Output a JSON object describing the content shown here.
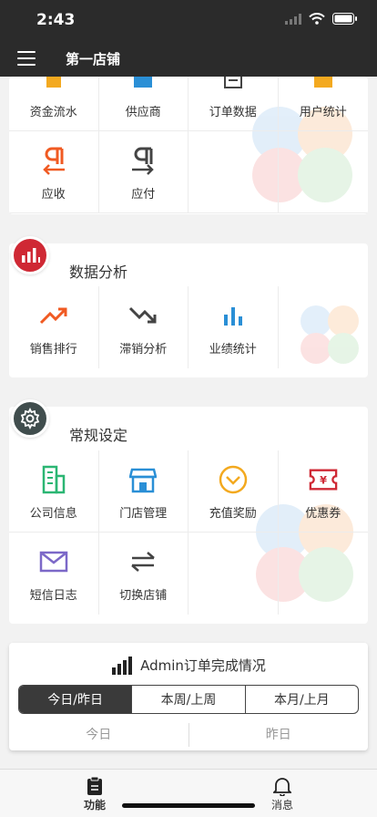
{
  "status_bar": {
    "time": "2:43"
  },
  "nav": {
    "title": "第一店铺"
  },
  "finance_section": {
    "row1": [
      "资金流水",
      "供应商",
      "订单数据",
      "用户统计"
    ],
    "row2": [
      "应收",
      "应付"
    ]
  },
  "analysis_section": {
    "title": "数据分析",
    "items": [
      "销售排行",
      "滞销分析",
      "业绩统计"
    ]
  },
  "settings_section": {
    "title": "常规设定",
    "items": [
      "公司信息",
      "门店管理",
      "充值奖励",
      "优惠券",
      "短信日志",
      "切换店铺"
    ]
  },
  "order_status": {
    "title": "Admin订单完成情况",
    "segments": [
      "今日/昨日",
      "本周/上周",
      "本月/上月"
    ],
    "active_segment": "今日/昨日",
    "compare": [
      "今日",
      "昨日"
    ]
  },
  "tabbar": {
    "items": [
      "功能",
      "消息"
    ]
  },
  "colors": {
    "header_bg": "#2b2b2b",
    "orange": "#f05a22",
    "blue": "#2a8fd6",
    "green": "#2bb673",
    "yellow": "#f3a91f",
    "red": "#cf2834",
    "purple": "#7c68c8",
    "dark": "#444444"
  }
}
